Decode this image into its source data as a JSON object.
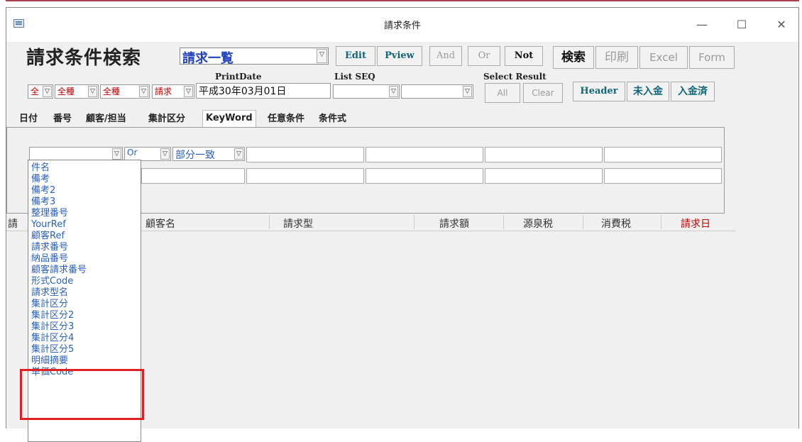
{
  "window": {
    "title": "請求条件"
  },
  "header": {
    "heading": "請求条件検索",
    "view_select": "請求一覧",
    "buttons": {
      "edit": "Edit",
      "pview": "Pview",
      "and": "And",
      "or": "Or",
      "not": "Not",
      "search": "検索",
      "print": "印刷",
      "excel": "Excel",
      "form": "Form"
    }
  },
  "labels": {
    "print_date": "PrintDate",
    "list_seq": "List SEQ",
    "select_result": "Select Result"
  },
  "filters": {
    "all1": "全",
    "kind1": "全種",
    "kind2": "全種",
    "billing": "請求",
    "date": "平成30年03月01日",
    "list_seq": "",
    "extra": ""
  },
  "result_buttons": {
    "all": "All",
    "clear": "Clear",
    "header": "Header",
    "unpaid": "未入金",
    "paid": "入金済"
  },
  "tabs": [
    "日付",
    "番号",
    "顧客/担当",
    "集計区分",
    "KeyWord",
    "任意条件",
    "条件式"
  ],
  "keyword_row": {
    "field": "",
    "logic": "Or",
    "match": "部分一致"
  },
  "columns": [
    "請",
    "顧客名",
    "請求型",
    "請求額",
    "源泉税",
    "消費税",
    "請求日"
  ],
  "dropdown_items": [
    "件名",
    "備考",
    "備考2",
    "備考3",
    "整理番号",
    "YourRef",
    "顧客Ref",
    "請求番号",
    "納品番号",
    "顧客請求番号",
    "形式Code",
    "請求型名",
    "集計区分",
    "集計区分2",
    "集計区分3",
    "集計区分4",
    "集計区分5",
    "明細摘要",
    "単価Code"
  ],
  "colors": {
    "accent_teal": "#116677",
    "list_blue": "#2a5fbf",
    "highlight_red": "#e02020",
    "date_header_red": "#c00000"
  }
}
